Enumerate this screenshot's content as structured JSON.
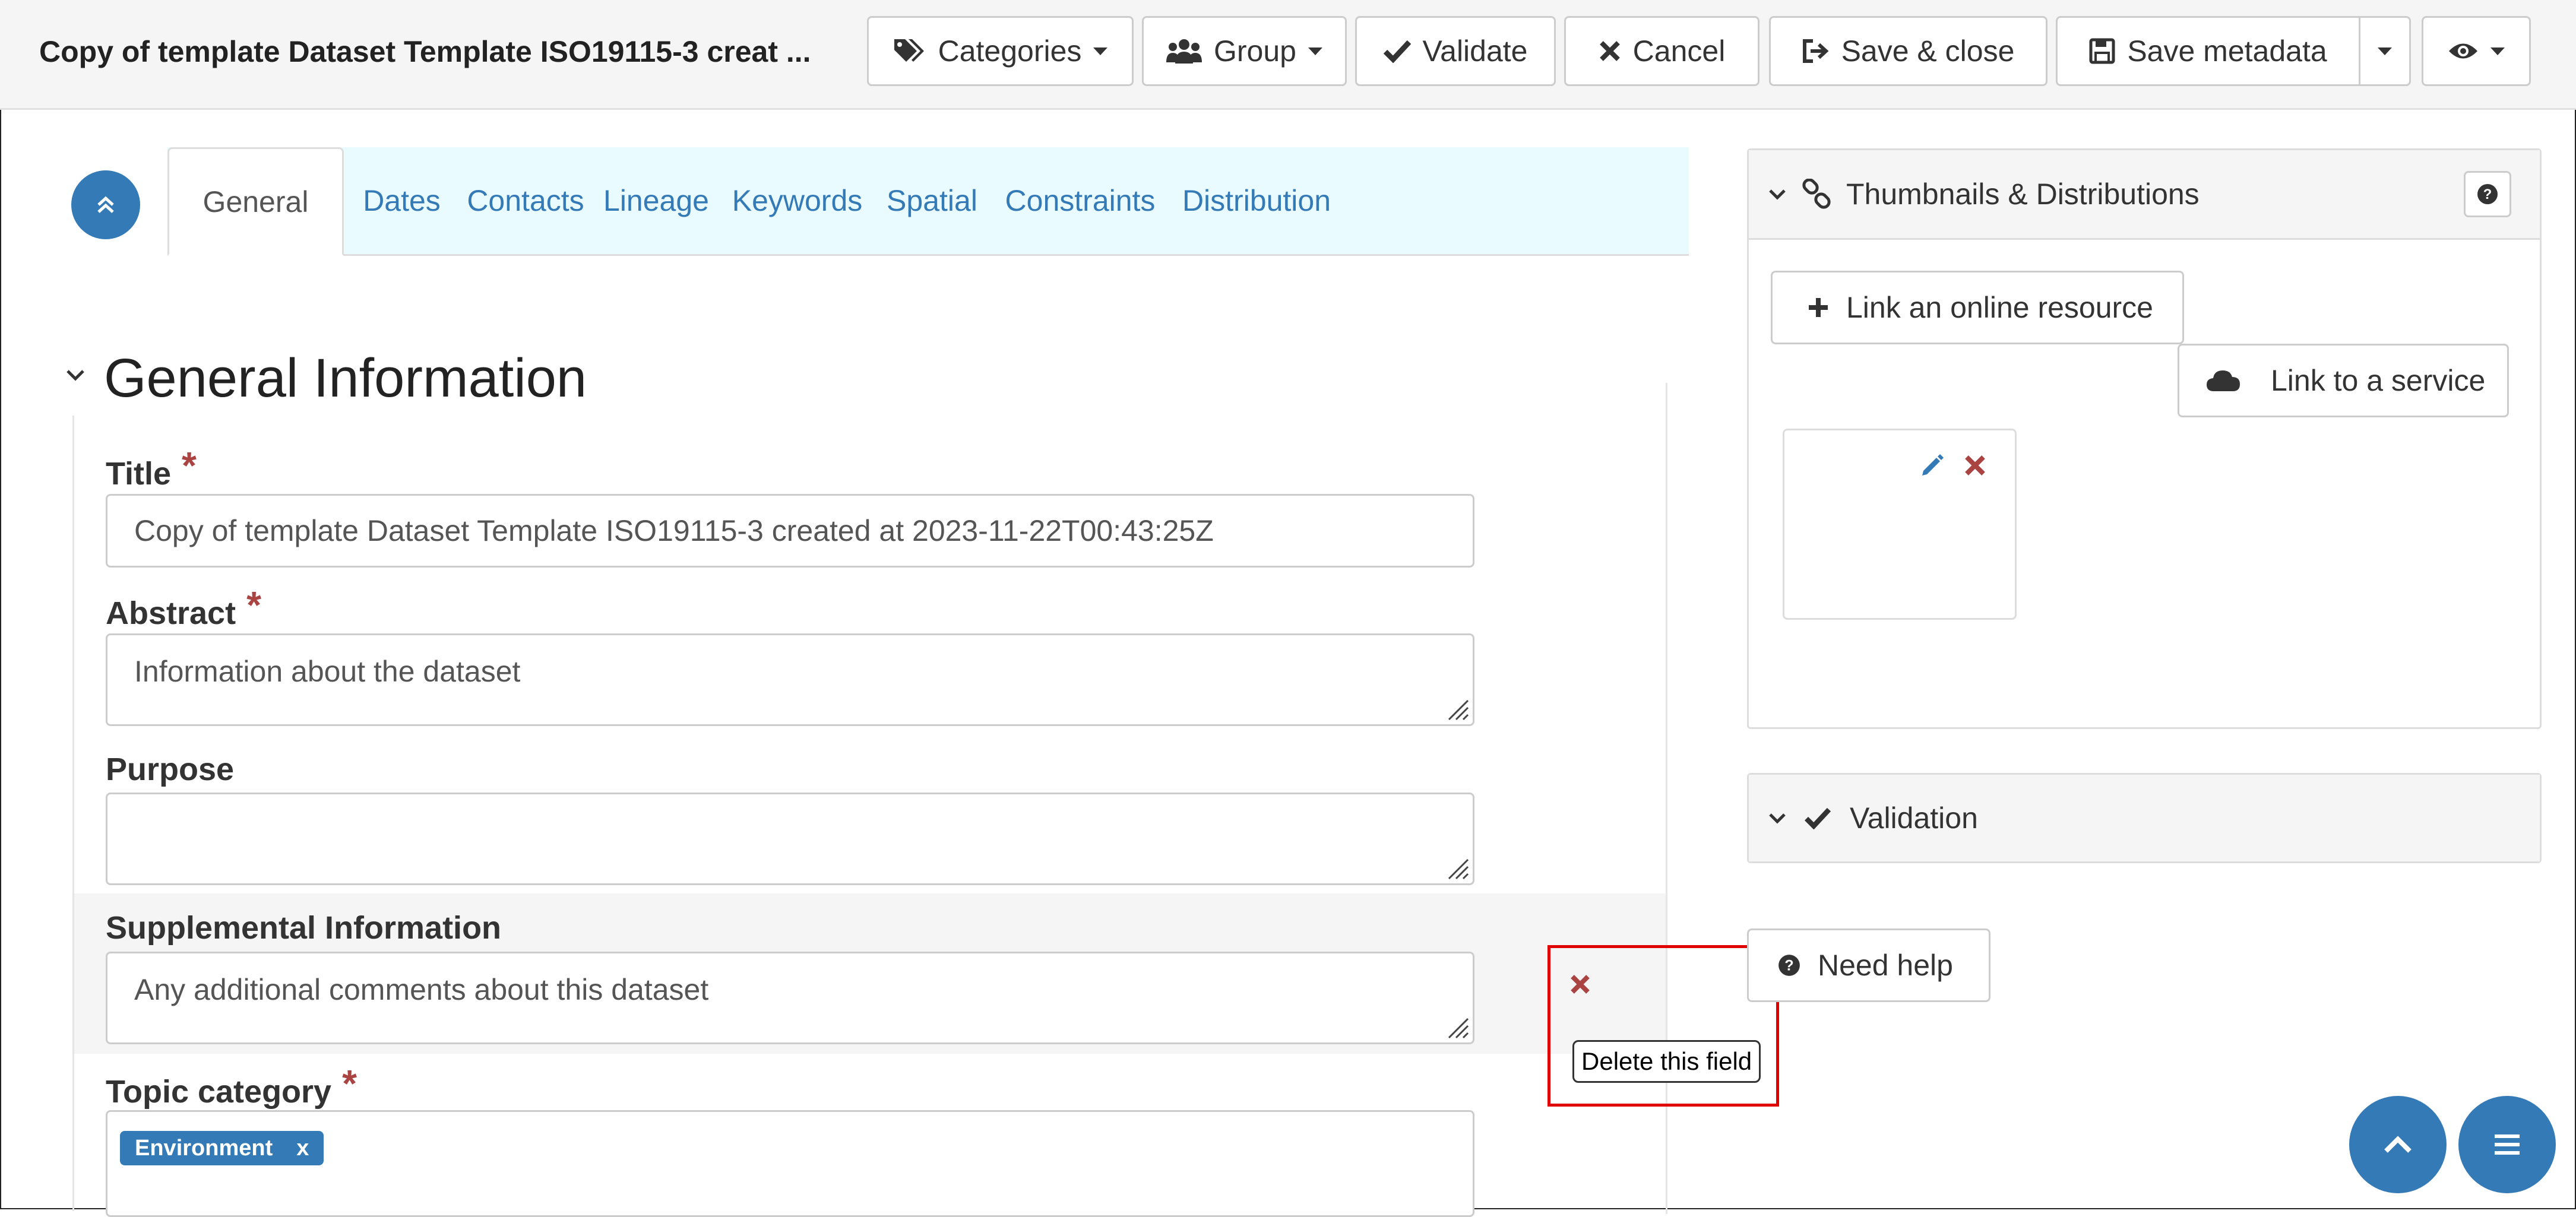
{
  "toolbar": {
    "title": "Copy of template Dataset Template ISO19115-3 creat ...",
    "categories": "Categories",
    "group": "Group",
    "validate": "Validate",
    "cancel": "Cancel",
    "save_close": "Save & close",
    "save_metadata": "Save metadata"
  },
  "tabs": [
    "General",
    "Dates",
    "Contacts",
    "Lineage",
    "Keywords",
    "Spatial",
    "Constraints",
    "Distribution"
  ],
  "section": {
    "title": "General Information"
  },
  "fields": {
    "title": {
      "label": "Title",
      "value": "Copy of template Dataset Template ISO19115-3 created at 2023-11-22T00:43:25Z",
      "required": "*"
    },
    "abstract": {
      "label": "Abstract",
      "value": "Information about the dataset",
      "required": "*"
    },
    "purpose": {
      "label": "Purpose",
      "value": ""
    },
    "supplemental": {
      "label": "Supplemental Information",
      "value": "Any additional comments about this dataset"
    },
    "topic": {
      "label": "Topic category",
      "required": "*",
      "tag": "Environment",
      "tag_remove": "x"
    }
  },
  "tooltip": {
    "text": "Delete this field"
  },
  "right_panel": {
    "thumbnails": {
      "title": "Thumbnails & Distributions",
      "link_online": "Link an online resource",
      "link_service": "Link to a service"
    },
    "validation": {
      "title": "Validation"
    },
    "need_help": "Need help"
  },
  "colors": {
    "primary": "#337ab7",
    "danger": "#a94442",
    "tab_bg": "#e9fbfe",
    "highlight": "#e00000"
  }
}
